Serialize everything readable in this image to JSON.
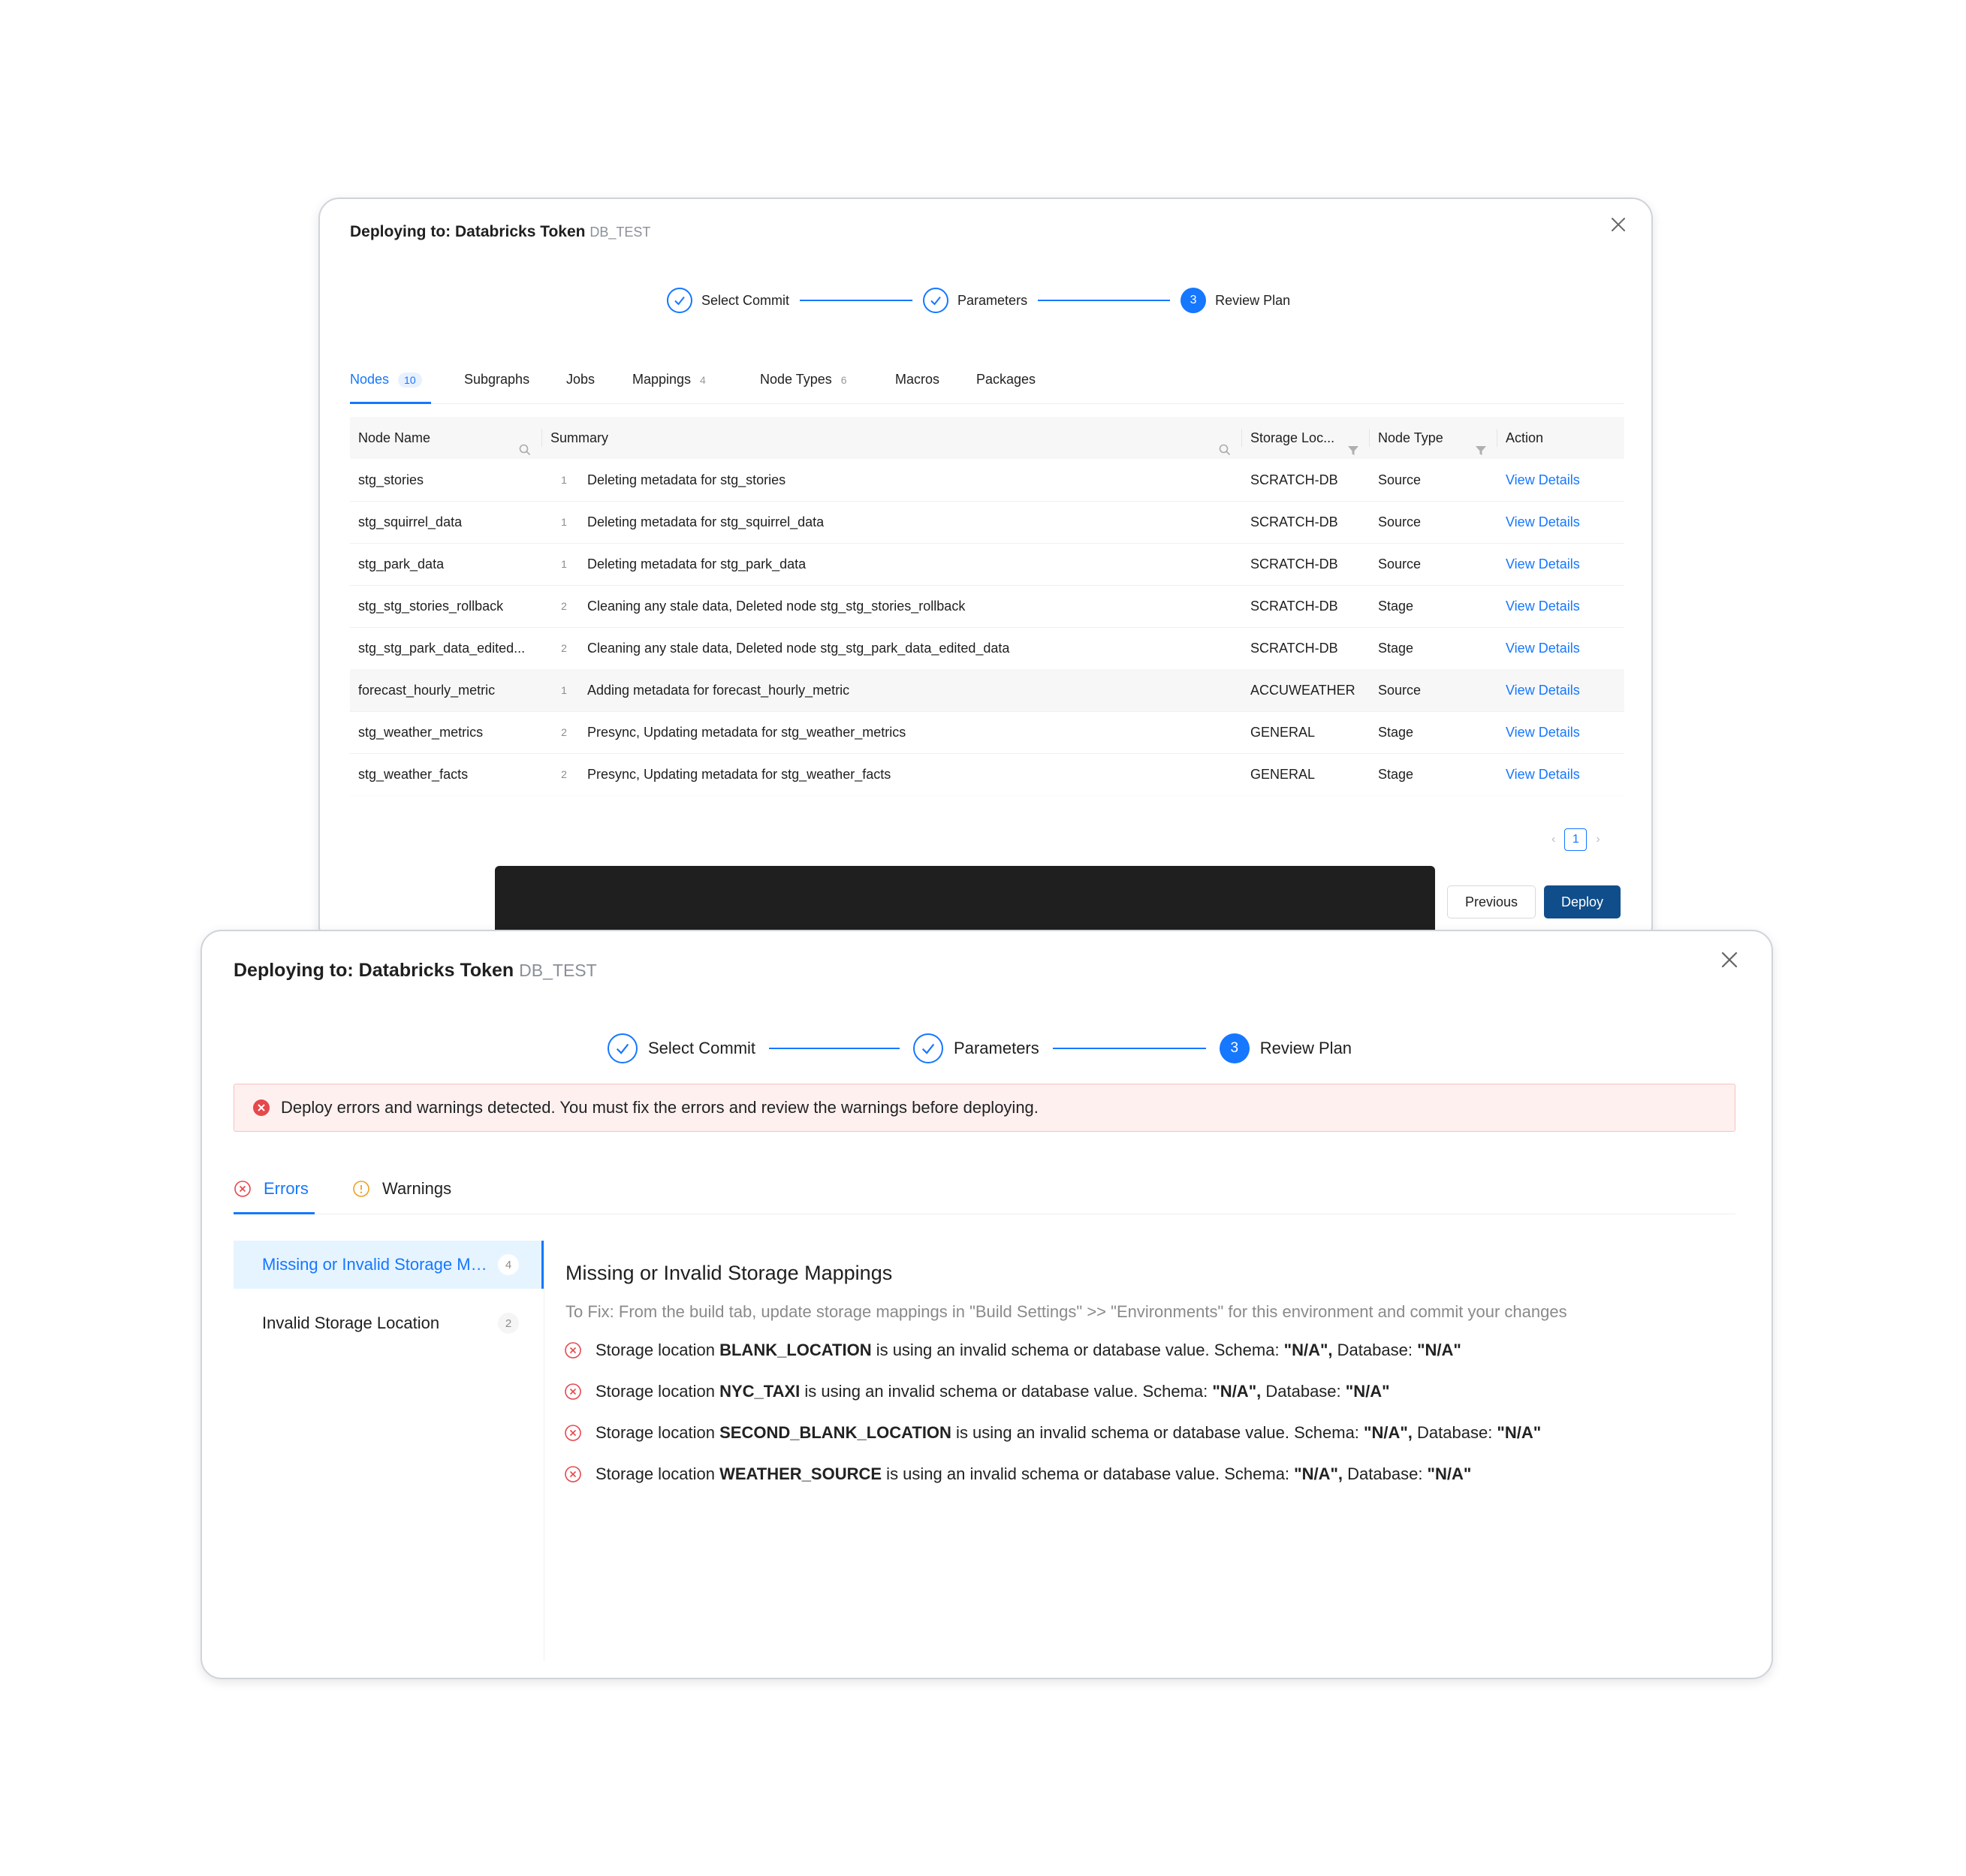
{
  "top_modal": {
    "title": "Deploying to: Databricks Token",
    "env": "DB_TEST",
    "steps": [
      {
        "label": "Select Commit",
        "status": "done"
      },
      {
        "label": "Parameters",
        "status": "done"
      },
      {
        "label": "Review Plan",
        "status": "current",
        "number": "3"
      }
    ],
    "tabs": [
      {
        "label": "Nodes",
        "count": "10",
        "active": true
      },
      {
        "label": "Subgraphs",
        "count": ""
      },
      {
        "label": "Jobs",
        "count": ""
      },
      {
        "label": "Mappings",
        "count": "4"
      },
      {
        "label": "Node Types",
        "count": "6"
      },
      {
        "label": "Macros",
        "count": ""
      },
      {
        "label": "Packages",
        "count": ""
      }
    ],
    "table": {
      "columns": [
        "Node Name",
        "Summary",
        "Storage Loc...",
        "Node Type",
        "Action"
      ],
      "rows": [
        {
          "name": "stg_stories",
          "count": "1",
          "summary": "Deleting metadata for stg_stories",
          "storage": "SCRATCH-DB",
          "type": "Source",
          "action": "View Details"
        },
        {
          "name": "stg_squirrel_data",
          "count": "1",
          "summary": "Deleting metadata for stg_squirrel_data",
          "storage": "SCRATCH-DB",
          "type": "Source",
          "action": "View Details"
        },
        {
          "name": "stg_park_data",
          "count": "1",
          "summary": "Deleting metadata for stg_park_data",
          "storage": "SCRATCH-DB",
          "type": "Source",
          "action": "View Details"
        },
        {
          "name": "stg_stg_stories_rollback",
          "count": "2",
          "summary": "Cleaning any stale data, Deleted node stg_stg_stories_rollback",
          "storage": "SCRATCH-DB",
          "type": "Stage",
          "action": "View Details"
        },
        {
          "name": "stg_stg_park_data_edited...",
          "count": "2",
          "summary": "Cleaning any stale data, Deleted node stg_stg_park_data_edited_data",
          "storage": "SCRATCH-DB",
          "type": "Stage",
          "action": "View Details"
        },
        {
          "name": "forecast_hourly_metric",
          "count": "1",
          "summary": "Adding metadata for forecast_hourly_metric",
          "storage": "ACCUWEATHER",
          "type": "Source",
          "action": "View Details",
          "highlight": true
        },
        {
          "name": "stg_weather_metrics",
          "count": "2",
          "summary": "Presync, Updating metadata for stg_weather_metrics",
          "storage": "GENERAL",
          "type": "Stage",
          "action": "View Details"
        },
        {
          "name": "stg_weather_facts",
          "count": "2",
          "summary": "Presync, Updating metadata for stg_weather_facts",
          "storage": "GENERAL",
          "type": "Stage",
          "action": "View Details"
        }
      ]
    },
    "pagination": {
      "current_page": "1"
    },
    "buttons": {
      "previous": "Previous",
      "deploy": "Deploy"
    }
  },
  "bottom_modal": {
    "title": "Deploying to: Databricks Token",
    "env": "DB_TEST",
    "steps": [
      {
        "label": "Select Commit",
        "status": "done"
      },
      {
        "label": "Parameters",
        "status": "done"
      },
      {
        "label": "Review Plan",
        "status": "current",
        "number": "3"
      }
    ],
    "alert": "Deploy errors and warnings detected. You must fix the errors and review the warnings before deploying.",
    "tabs": [
      {
        "label": "Errors",
        "active": true,
        "icon": "error-circle-icon"
      },
      {
        "label": "Warnings",
        "active": false,
        "icon": "warning-circle-icon"
      }
    ],
    "sidebar": [
      {
        "label": "Missing or Invalid Storage Mappings",
        "count": "4",
        "active": true
      },
      {
        "label": "Invalid Storage Location",
        "count": "2",
        "active": false
      }
    ],
    "detail": {
      "title": "Missing or Invalid Storage Mappings",
      "fix": "To Fix: From the build tab, update storage mappings in \"Build Settings\" >> \"Environments\" for this environment and commit your changes",
      "errors": [
        {
          "prefix": "Storage location ",
          "name": "BLANK_LOCATION",
          "middle": " is using an invalid schema or database value. Schema: ",
          "schema": "\"N/A\",",
          "db_label": " Database: ",
          "database": "\"N/A\""
        },
        {
          "prefix": "Storage location ",
          "name": "NYC_TAXI",
          "middle": " is using an invalid schema or database value. Schema: ",
          "schema": "\"N/A\",",
          "db_label": " Database: ",
          "database": "\"N/A\""
        },
        {
          "prefix": "Storage location ",
          "name": "SECOND_BLANK_LOCATION",
          "middle": " is using an invalid schema or database value. Schema: ",
          "schema": "\"N/A\",",
          "db_label": " Database: ",
          "database": "\"N/A\""
        },
        {
          "prefix": "Storage location ",
          "name": "WEATHER_SOURCE",
          "middle": " is using an invalid schema or database value. Schema: ",
          "schema": "\"N/A\",",
          "db_label": " Database: ",
          "database": "\"N/A\""
        }
      ]
    }
  },
  "colors": {
    "accent": "#1677ff",
    "deploy_button": "#104e8b",
    "error": "#e5484d",
    "warning": "#f0a020",
    "alert_bg": "#fff0f0"
  }
}
